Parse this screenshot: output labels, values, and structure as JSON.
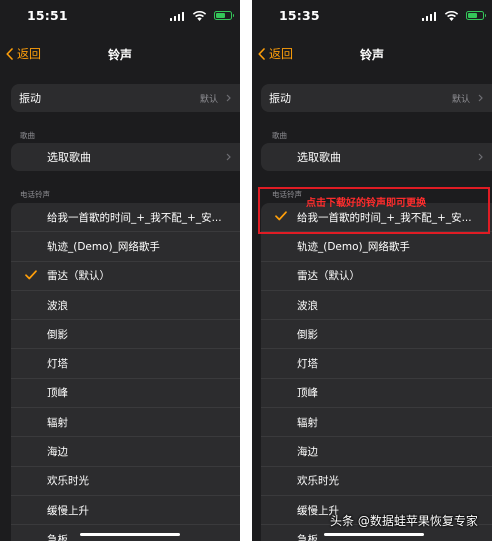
{
  "left": {
    "time": "15:51",
    "nav": {
      "back": "返回",
      "title": "铃声"
    },
    "vibration": {
      "label": "振动",
      "value": "默认"
    },
    "songs_header": "歌曲",
    "pick_song": "选取歌曲",
    "ringtones_header": "电话铃声",
    "ringtones": [
      "给我一首歌的时间_+_我不配_+_安...",
      "轨迹_(Demo)_网络歌手",
      "雷达（默认）",
      "波浪",
      "倒影",
      "灯塔",
      "顶峰",
      "辐射",
      "海边",
      "欢乐时光",
      "缓慢上升",
      "急板"
    ]
  },
  "right": {
    "time": "15:35",
    "nav": {
      "back": "返回",
      "title": "铃声"
    },
    "vibration": {
      "label": "振动",
      "value": "默认"
    },
    "songs_header": "歌曲",
    "pick_song": "选取歌曲",
    "ringtones_header": "电话铃声",
    "ringtones": [
      "给我一首歌的时间_+_我不配_+_安...",
      "轨迹_(Demo)_网络歌手",
      "雷达（默认）",
      "波浪",
      "倒影",
      "灯塔",
      "顶峰",
      "辐射",
      "海边",
      "欢乐时光",
      "缓慢上升",
      "急板"
    ]
  },
  "annotation": "点击下载好的铃声即可更换",
  "watermark": "头条 @数据蛙苹果恢复专家",
  "colors": {
    "accent": "#ff9f0a",
    "background": "#1c1c1e",
    "cell": "#2c2c2e",
    "annotation": "#e01c24"
  }
}
